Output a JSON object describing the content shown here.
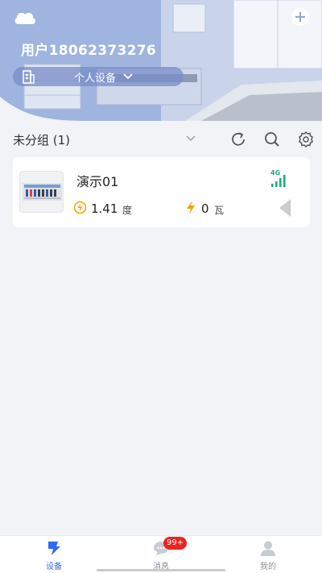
{
  "header": {
    "user_label": "用户18062373276",
    "group_selector": "个人设备",
    "icons": {
      "weather": "cloud-icon",
      "add": "plus-circle-icon",
      "building": "building-icon",
      "chevron": "chevron-down-icon"
    }
  },
  "toolbar": {
    "group_title": "未分组 (1)",
    "icons": [
      "chevron-down-icon",
      "refresh-icon",
      "search-icon",
      "settings-icon"
    ]
  },
  "devices": [
    {
      "name": "演示01",
      "network": "4G",
      "energy_value": "1.41",
      "energy_unit": "度",
      "power_value": "0",
      "power_unit": "瓦"
    }
  ],
  "tabbar": {
    "items": [
      {
        "label": "设备",
        "icon": "device-icon",
        "active": true
      },
      {
        "label": "消息",
        "icon": "message-icon",
        "active": false
      },
      {
        "label": "我的",
        "icon": "profile-icon",
        "active": false
      }
    ],
    "message_badge": "99+"
  },
  "colors": {
    "accent": "#2f6bf0",
    "signal": "#1aa873",
    "energy": "#f0a500",
    "badge": "#e8251f"
  }
}
